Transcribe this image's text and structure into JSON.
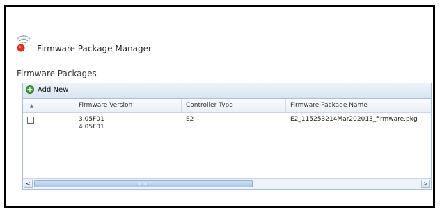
{
  "app": {
    "title": "Firmware Package Manager",
    "logo_icon": "wireless-logo-icon"
  },
  "section": {
    "title": "Firmware Packages"
  },
  "toolbar": {
    "add_new_label": "Add New",
    "add_icon": "plus-icon"
  },
  "grid": {
    "columns": [
      "",
      "Firmware Version",
      "Controller Type",
      "Firmware Package Name"
    ],
    "rows": [
      {
        "selected": false,
        "firmware_version_1": "3.05F01",
        "firmware_version_2": "4.05F01",
        "controller_type": "E2",
        "package_name": "E2_115253214Mar202013_firmware.pkg"
      }
    ]
  },
  "scrollbar": {
    "left_arrow": "<",
    "right_arrow": ">"
  },
  "colors": {
    "accent": "#3a9a2e",
    "panel_border": "#a9bfd6",
    "header_bg": "#d8e5f4",
    "logo_red": "#d9341f"
  }
}
